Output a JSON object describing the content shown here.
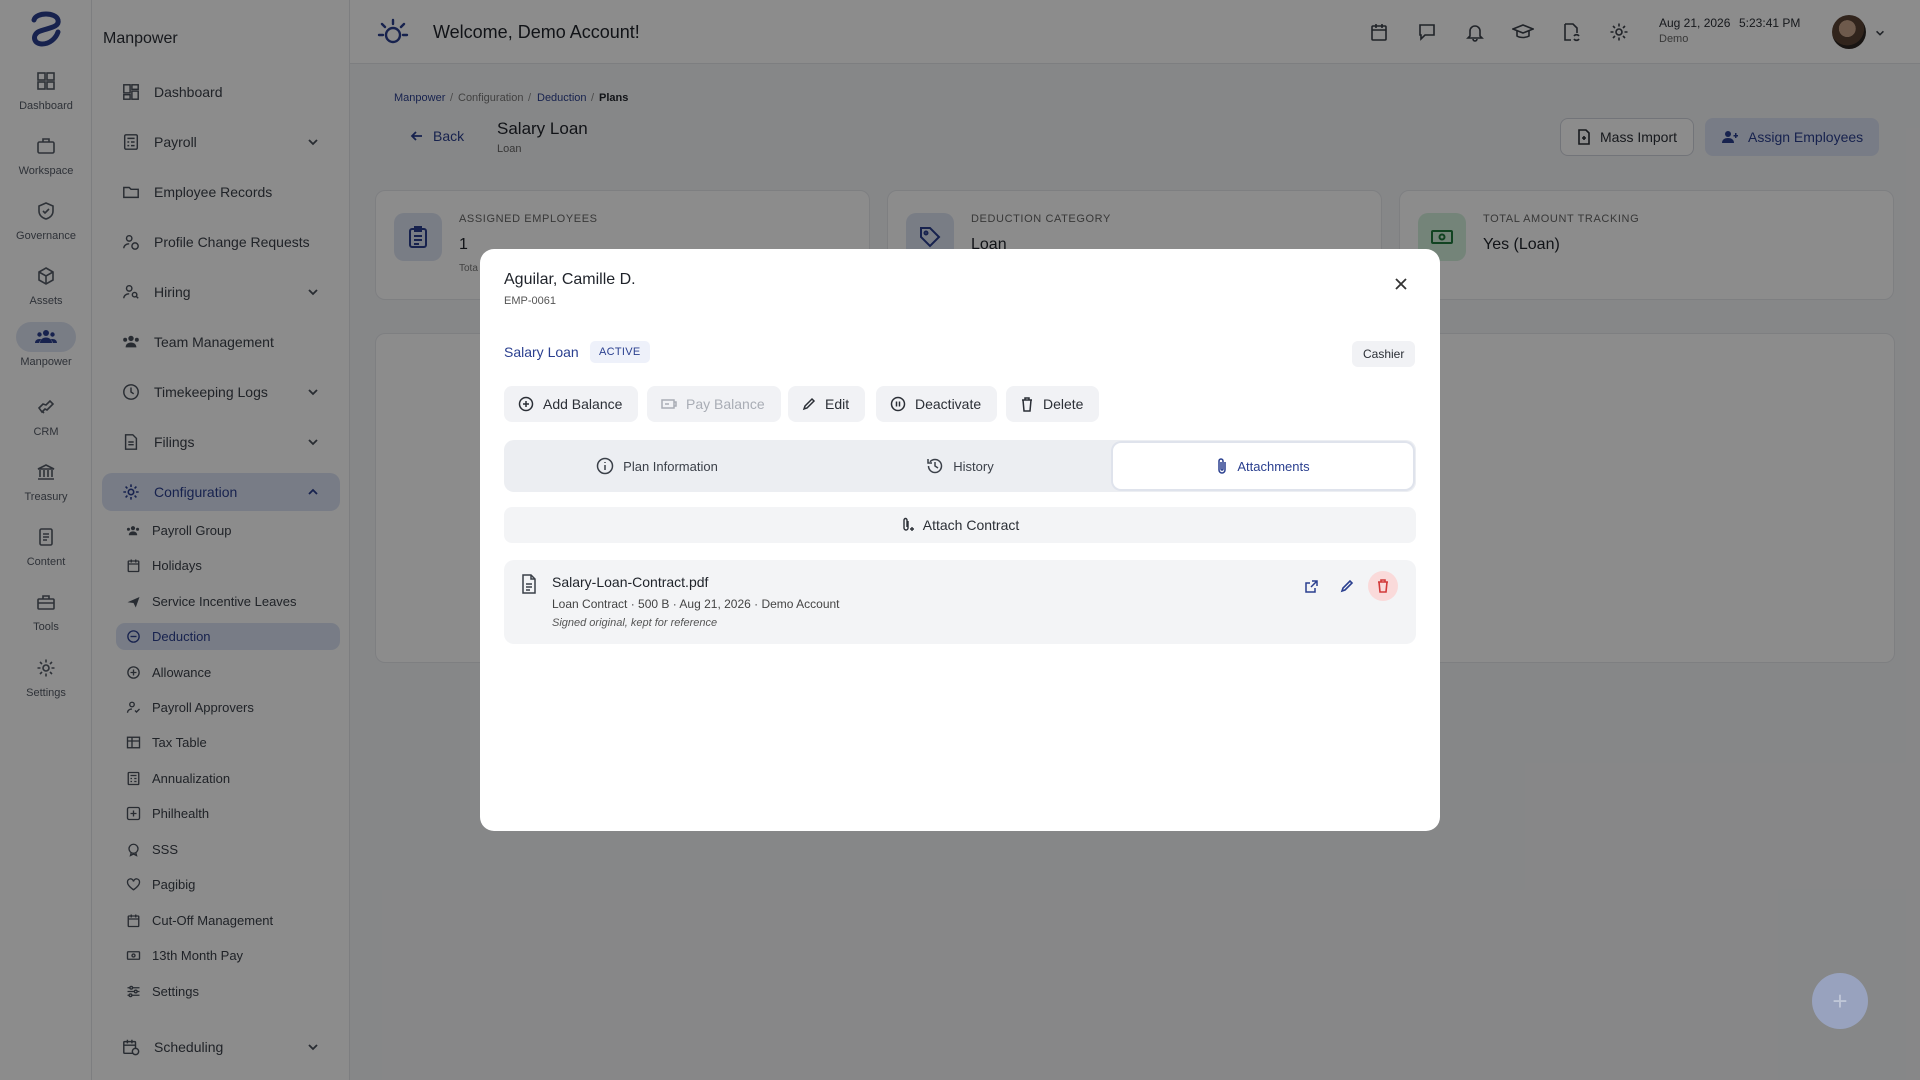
{
  "rail": {
    "items": [
      {
        "label": "Dashboard",
        "icon": "dashboard-icon"
      },
      {
        "label": "Workspace",
        "icon": "briefcase-icon"
      },
      {
        "label": "Governance",
        "icon": "shield-check-icon"
      },
      {
        "label": "Assets",
        "icon": "cube-icon"
      },
      {
        "label": "Manpower",
        "icon": "people-icon"
      },
      {
        "label": "CRM",
        "icon": "handshake-icon"
      },
      {
        "label": "Treasury",
        "icon": "bank-icon"
      },
      {
        "label": "Content",
        "icon": "document-icon"
      },
      {
        "label": "Tools",
        "icon": "toolbox-icon"
      },
      {
        "label": "Settings",
        "icon": "gear-icon"
      }
    ]
  },
  "sidebar": {
    "title": "Manpower",
    "items": [
      {
        "label": "Dashboard"
      },
      {
        "label": "Payroll"
      },
      {
        "label": "Employee Records"
      },
      {
        "label": "Profile Change Requests"
      },
      {
        "label": "Hiring"
      },
      {
        "label": "Team Management"
      },
      {
        "label": "Timekeeping Logs"
      },
      {
        "label": "Filings"
      },
      {
        "label": "Configuration"
      },
      {
        "label": "Scheduling"
      }
    ],
    "config_items": [
      {
        "label": "Payroll Group"
      },
      {
        "label": "Holidays"
      },
      {
        "label": "Service Incentive Leaves"
      },
      {
        "label": "Deduction"
      },
      {
        "label": "Allowance"
      },
      {
        "label": "Payroll Approvers"
      },
      {
        "label": "Tax Table"
      },
      {
        "label": "Annualization"
      },
      {
        "label": "Philhealth"
      },
      {
        "label": "SSS"
      },
      {
        "label": "Pagibig"
      },
      {
        "label": "Cut-Off Management"
      },
      {
        "label": "13th Month Pay"
      },
      {
        "label": "Settings"
      }
    ]
  },
  "header": {
    "welcome": "Welcome, Demo Account!",
    "date": "Aug 21, 2026",
    "time": "5:23:41 PM",
    "user": "Demo"
  },
  "page": {
    "breadcrumb": [
      "Manpower",
      "Configuration",
      "Deduction",
      "Plans"
    ],
    "back_label": "Back",
    "title": "Salary Loan",
    "subtitle": "Loan",
    "mass_import": "Mass Import",
    "assign_employees": "Assign Employees",
    "cards": [
      {
        "label": "ASSIGNED EMPLOYEES",
        "value": "1",
        "note": "Tota"
      },
      {
        "label": "DEDUCTION CATEGORY",
        "value": "Loan"
      },
      {
        "label": "TOTAL AMOUNT TRACKING",
        "value": "Yes (Loan)"
      }
    ]
  },
  "modal": {
    "employee_name": "Aguilar, Camille D.",
    "employee_id": "EMP-0061",
    "plan_name": "Salary Loan",
    "status": "ACTIVE",
    "position": "Cashier",
    "actions": {
      "add_balance": "Add Balance",
      "pay_balance": "Pay Balance",
      "edit": "Edit",
      "deactivate": "Deactivate",
      "delete": "Delete"
    },
    "tabs": [
      {
        "label": "Plan Information"
      },
      {
        "label": "History"
      },
      {
        "label": "Attachments"
      }
    ],
    "attach_label": "Attach Contract",
    "file": {
      "name": "Salary-Loan-Contract.pdf",
      "meta": "Loan Contract · 500 B · Aug 21, 2026 · Demo Account",
      "note": "Signed original, kept for reference"
    }
  },
  "colors": {
    "accent": "#2a3f8f",
    "accent_soft": "#dbe2f4",
    "danger": "#d23a3a"
  }
}
